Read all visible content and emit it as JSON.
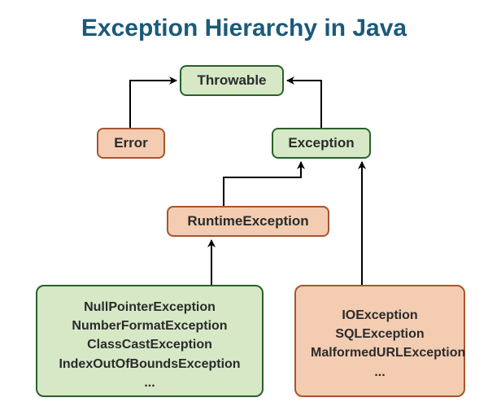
{
  "title": "Exception Hierarchy in Java",
  "nodes": {
    "throwable": "Throwable",
    "error": "Error",
    "exception": "Exception",
    "runtime": "RuntimeException"
  },
  "runtimeChildren": {
    "l1": "NullPointerException",
    "l2": "NumberFormatException",
    "l3": "ClassCastException",
    "l4": "IndexOutOfBoundsException",
    "l5": "..."
  },
  "exceptionChildren": {
    "l1": "IOException",
    "l2": "SQLException",
    "l3": "MalformedURLException",
    "l4": "..."
  }
}
